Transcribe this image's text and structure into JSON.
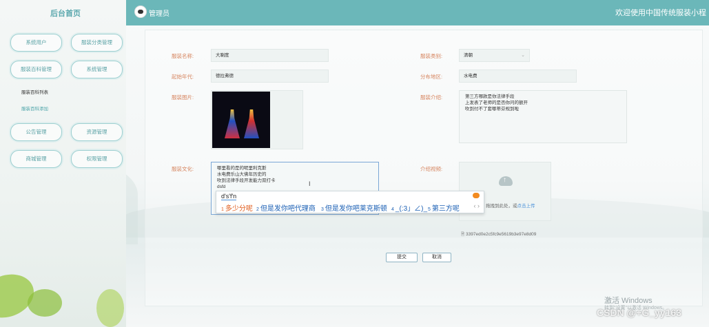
{
  "sidebar": {
    "title": "后台首页",
    "menu": [
      {
        "label": "系统用户"
      },
      {
        "label": "服装分类管理"
      },
      {
        "label": "服装百科管理"
      },
      {
        "label": "系统管理"
      },
      {
        "label": "公告管理"
      },
      {
        "label": "资源管理"
      },
      {
        "label": "商城管理"
      },
      {
        "label": "权限管理"
      }
    ],
    "submenu": [
      {
        "label": "服装百科列表",
        "color": "#333333"
      },
      {
        "label": "服装百科添加",
        "color": "#4aa3a8"
      }
    ]
  },
  "header": {
    "admin": "管理员",
    "welcome": "欢迎使用中国传统服装小程"
  },
  "form": {
    "name_label": "服装名称:",
    "name_value": "大喇度",
    "category_label": "服装类别:",
    "category_value": "清朝",
    "era_label": "起始年代:",
    "era_value": "德拉弗德",
    "region_label": "分布地区:",
    "region_value": "水电费",
    "image_label": "服装图片:",
    "intro_label": "服装介绍:",
    "intro_lines": [
      "第三方哪款是你法律手段",
      "上发表了老师的是否你问的额开",
      "吹到付不了套哪蒂芬规到啦"
    ],
    "culture_label": "服装文化:",
    "culture_lines": [
      "哪里看的是的呢里利克斯",
      "水电费乐山大佛年历史的",
      "吹到法律手段开发能力双打卡",
      "dsfd"
    ],
    "video_label": "介绍视频:",
    "upload_hint": "拖拽到此处，或",
    "upload_link": "点击上传",
    "file_name": "3397ed0e2c5fc9e5619b3e97e8d09",
    "submit_label": "提交",
    "cancel_label": "取消"
  },
  "ime": {
    "composition": "d's'f'n",
    "candidates": [
      {
        "n": "1",
        "text": "多少分呢"
      },
      {
        "n": "2",
        "text": "但是发你吧代理商"
      },
      {
        "n": "3",
        "text": "但是发你吧莱克斯顿"
      },
      {
        "n": "4",
        "text": "_(:3」∠)_"
      },
      {
        "n": "5",
        "text": "第三方呢"
      }
    ],
    "arrows": "‹ ›"
  },
  "overlay": {
    "activate_title": "激活 Windows",
    "activate_sub": "转到\"设置\"以激活 Windows。",
    "csdn": "CSDN @+G_yy163"
  }
}
